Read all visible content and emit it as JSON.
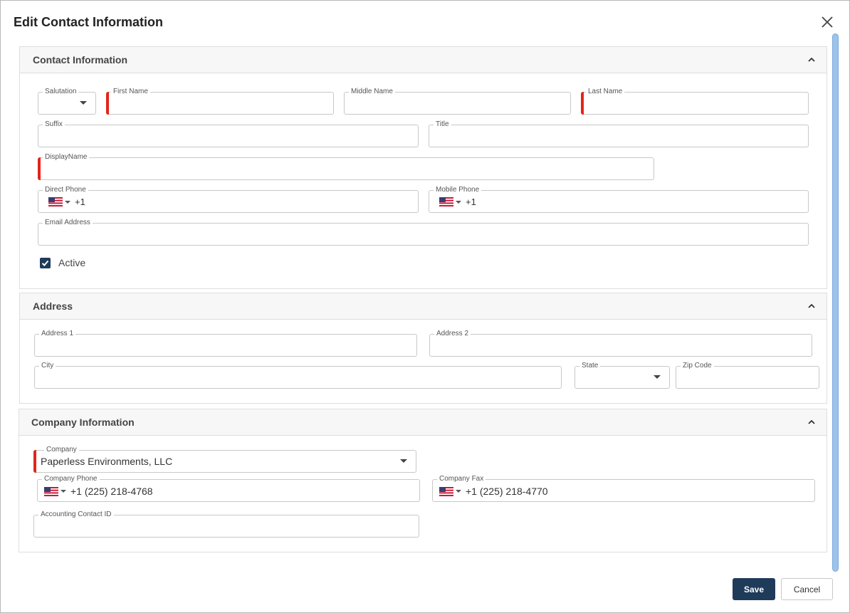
{
  "dialog": {
    "title": "Edit Contact Information",
    "close_icon": "close-icon",
    "save_label": "Save",
    "cancel_label": "Cancel"
  },
  "contact": {
    "header": "Contact Information",
    "salutation": {
      "label": "Salutation",
      "value": ""
    },
    "first_name": {
      "label": "First Name",
      "value": ""
    },
    "middle_name": {
      "label": "Middle Name",
      "value": ""
    },
    "last_name": {
      "label": "Last Name",
      "value": ""
    },
    "suffix": {
      "label": "Suffix",
      "value": ""
    },
    "title": {
      "label": "Title",
      "value": ""
    },
    "display_name": {
      "label": "DisplayName",
      "value": ""
    },
    "direct_phone": {
      "label": "Direct Phone",
      "value": "+1"
    },
    "mobile_phone": {
      "label": "Mobile Phone",
      "value": "+1"
    },
    "email": {
      "label": "Email Address",
      "value": ""
    },
    "active": {
      "label": "Active",
      "checked": true
    }
  },
  "address": {
    "header": "Address",
    "address1": {
      "label": "Address 1",
      "value": ""
    },
    "address2": {
      "label": "Address 2",
      "value": ""
    },
    "city": {
      "label": "City",
      "value": ""
    },
    "state": {
      "label": "State",
      "value": ""
    },
    "zip": {
      "label": "Zip Code",
      "value": ""
    }
  },
  "company": {
    "header": "Company Information",
    "company": {
      "label": "Company",
      "value": "Paperless Environments, LLC"
    },
    "company_phone": {
      "label": "Company Phone",
      "value": "+1 (225) 218-4768"
    },
    "company_fax": {
      "label": "Company Fax",
      "value": "+1 (225) 218-4770"
    },
    "accounting_id": {
      "label": "Accounting Contact ID",
      "value": ""
    }
  },
  "colors": {
    "primary": "#1f3b5a",
    "required": "#e1251b",
    "scrollbar": "#9ec3ea"
  }
}
